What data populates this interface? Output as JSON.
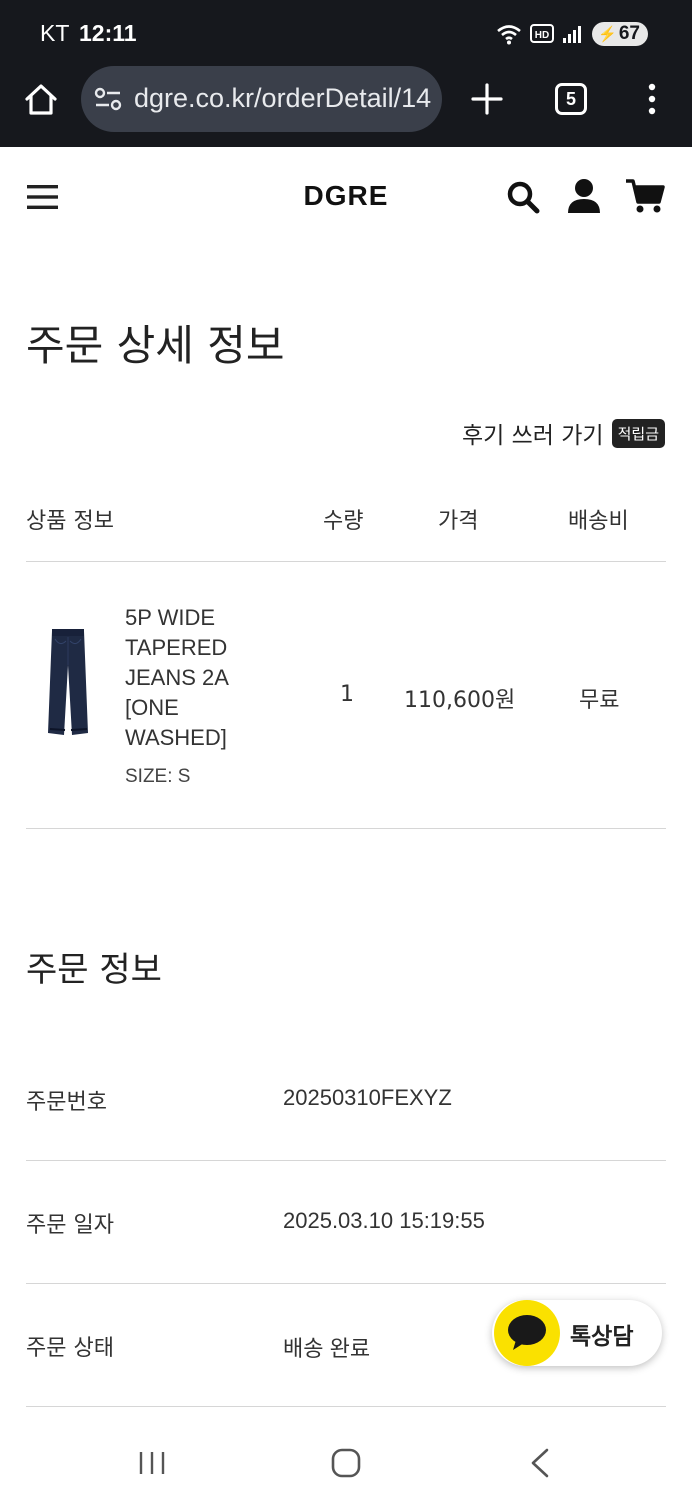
{
  "status_bar": {
    "carrier": "KT",
    "time": "12:11",
    "battery": "67",
    "icons": [
      "wifi-icon",
      "hd-voice-icon",
      "signal-icon",
      "battery-icon"
    ]
  },
  "browser": {
    "url": "dgre.co.kr/orderDetail/14",
    "tab_count": "5"
  },
  "site": {
    "logo": "DGRE"
  },
  "page": {
    "title": "주문 상세 정보",
    "review_link": "후기 쓰러 가기",
    "review_badge": "적립금"
  },
  "table": {
    "headers": {
      "product": "상품 정보",
      "quantity": "수량",
      "price": "가격",
      "shipping": "배송비"
    },
    "rows": [
      {
        "name": "5P WIDE TAPERED JEANS 2A [ONE WASHED]",
        "size": "SIZE: S",
        "quantity": "1",
        "price": "110,600원",
        "shipping": "무료"
      }
    ]
  },
  "order_info": {
    "title": "주문 정보",
    "rows": [
      {
        "label": "주문번호",
        "value": "20250310FEXYZ"
      },
      {
        "label": "주문 일자",
        "value": "2025.03.10 15:19:55"
      },
      {
        "label": "주문 상태",
        "value": "배송 완료"
      }
    ]
  },
  "chat": {
    "label": "톡상담",
    "color": "#FAE100"
  },
  "colors": {
    "chrome_bg": "#16181D",
    "urlbar_bg": "#3A3F4A",
    "text": "#222222",
    "divider": "#D6D6D6"
  }
}
